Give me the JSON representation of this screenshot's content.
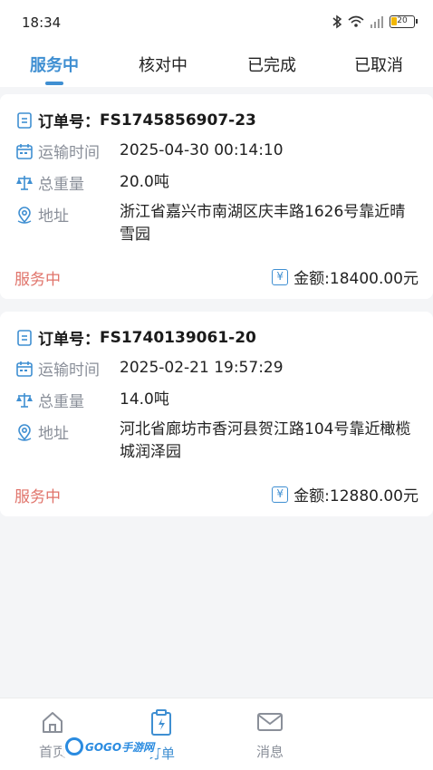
{
  "status_bar": {
    "time": "18:34",
    "battery": "20"
  },
  "tabs": [
    {
      "label": "服务中",
      "active": true
    },
    {
      "label": "核对中",
      "active": false
    },
    {
      "label": "已完成",
      "active": false
    },
    {
      "label": "已取消",
      "active": false
    }
  ],
  "orders": [
    {
      "order_label": "订单号：",
      "order_no": "FS1745856907-23",
      "time_label": "运输时间",
      "time": "2025-04-30 00:14:10",
      "weight_label": "总重量",
      "weight": "20.0吨",
      "address_label": "地址",
      "address": "浙江省嘉兴市南湖区庆丰路1626号靠近晴雪园",
      "status": "服务中",
      "amount": "金额:18400.00元"
    },
    {
      "order_label": "订单号：",
      "order_no": "FS1740139061-20",
      "time_label": "运输时间",
      "time": "2025-02-21 19:57:29",
      "weight_label": "总重量",
      "weight": "14.0吨",
      "address_label": "地址",
      "address": "河北省廊坊市香河县贺江路104号靠近橄榄城润泽园",
      "status": "服务中",
      "amount": "金额:12880.00元"
    }
  ],
  "bottom_nav": [
    {
      "label": "首页",
      "icon": "home-icon",
      "active": false
    },
    {
      "label": "订单",
      "icon": "order-icon",
      "active": true
    },
    {
      "label": "消息",
      "icon": "mail-icon",
      "active": false
    }
  ],
  "watermark": "GOGO手游网",
  "colors": {
    "accent": "#3f8fd2",
    "status": "#e0736a",
    "label": "#8a8f99"
  }
}
